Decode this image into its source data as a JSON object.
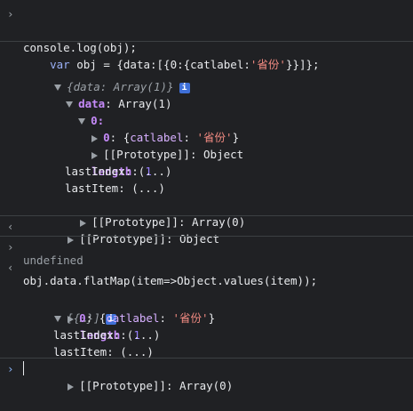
{
  "console": {
    "input1_line1": "var obj = {data:[{0:{catlabel:'省份'}}]};",
    "input1_line2": "console.log(obj);",
    "obj_summary": "{data: Array(1)}",
    "data_key": "data",
    "data_type": "Array(1)",
    "index_0": "0:",
    "index_0_key": "0",
    "catlabel_key": "catlabel",
    "catlabel_value": "'省份'",
    "proto_label": "[[Prototype]]",
    "proto_object": "Object",
    "length_key": "length",
    "length_value": "1",
    "lastIndex": "lastIndex: (...)",
    "lastItem": "lastItem: (...)",
    "proto_array": "Array(0)",
    "undefined_text": "undefined",
    "input2": "obj.data.flatMap(item=>Object.values(item));",
    "result_summary": "[{…}]",
    "info_icon_text": "i"
  }
}
